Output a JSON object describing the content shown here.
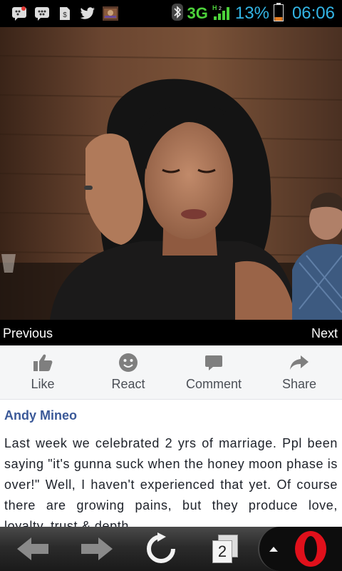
{
  "status_bar": {
    "network": "3G",
    "battery": "13%",
    "time": "06:06",
    "icons": [
      "bbm-icon",
      "bbm-icon",
      "file-icon",
      "twitter-icon",
      "app-icon",
      "bluetooth-icon",
      "signal-icon",
      "battery-icon"
    ]
  },
  "gallery": {
    "previous_label": "Previous",
    "next_label": "Next"
  },
  "actions": {
    "like": "Like",
    "react": "React",
    "comment": "Comment",
    "share": "Share"
  },
  "post": {
    "author": "Andy Mineo",
    "text": "Last week we celebrated 2 yrs of marriage. Ppl been saying \"it's gunna suck when the honey moon phase is over!\" Well, I haven't experienced that yet. Of course there are growing pains, but they produce love, loyalty, trust & depth."
  },
  "toolbar": {
    "tab_count": "2"
  },
  "colors": {
    "link": "#3b5998",
    "status_blue": "#33b5e5",
    "network_green": "#4cd13a",
    "opera_red": "#e0101b"
  }
}
